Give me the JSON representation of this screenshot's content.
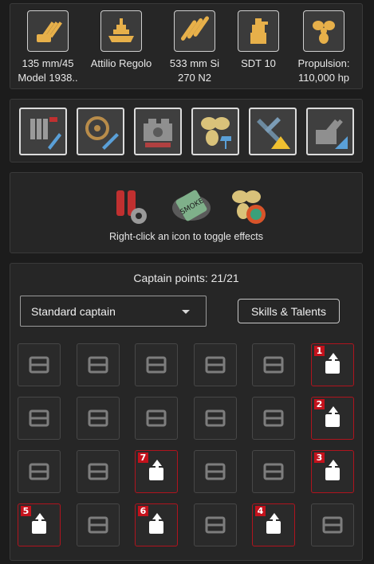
{
  "modules": [
    {
      "icon": "main-battery-icon",
      "line1": "135 mm/45",
      "line2": "Model 1938.."
    },
    {
      "icon": "hull-icon",
      "line1": "Attilio Regolo",
      "line2": ""
    },
    {
      "icon": "torpedo-icon",
      "line1": "533 mm Si",
      "line2": "270 N2"
    },
    {
      "icon": "fire-control-icon",
      "line1": "SDT 10",
      "line2": ""
    },
    {
      "icon": "propulsion-icon",
      "line1": "Propulsion:",
      "line2": "110,000 hp"
    }
  ],
  "upgrades": [
    {
      "icon": "main-armaments-mod-icon"
    },
    {
      "icon": "damage-control-mod-icon"
    },
    {
      "icon": "engine-room-mod-icon"
    },
    {
      "icon": "propulsion-mod-icon"
    },
    {
      "icon": "aircraft-warning-mod-icon"
    },
    {
      "icon": "gun-fire-control-mod-icon"
    }
  ],
  "consumables": {
    "items": [
      {
        "icon": "damage-control-party-icon"
      },
      {
        "icon": "smoke-generator-icon",
        "text": "SMOKE"
      },
      {
        "icon": "engine-boost-icon"
      }
    ],
    "hint": "Right-click an icon to toggle effects"
  },
  "captain": {
    "points_label": "Captain points: 21/21",
    "select_value": "Standard captain",
    "skills_button": "Skills & Talents",
    "accent": "#c4121c",
    "skills": [
      {
        "icon": "grease-the-gears-icon",
        "order": null
      },
      {
        "icon": "gun-feeder-icon",
        "order": null
      },
      {
        "icon": "torpedo-armament-expertise-icon",
        "order": null
      },
      {
        "icon": "consumables-specialist-icon",
        "order": null
      },
      {
        "icon": "preventive-maintenance-icon",
        "order": null
      },
      {
        "icon": "priority-target-icon",
        "order": "1"
      },
      {
        "icon": "demolition-expert-icon",
        "order": null
      },
      {
        "icon": "main-battery-specialist-icon",
        "order": null
      },
      {
        "icon": "torpedo-aiming-icon",
        "order": null
      },
      {
        "icon": "inertia-fuse-icon",
        "order": null
      },
      {
        "icon": "incoming-fire-alert-icon",
        "order": null
      },
      {
        "icon": "consumables-enhancements-icon",
        "order": "2"
      },
      {
        "icon": "secondary-armament-icon",
        "order": null
      },
      {
        "icon": "main-battery-reload-icon",
        "order": null
      },
      {
        "icon": "swift-fish-icon",
        "order": "7"
      },
      {
        "icon": "aa-defense-icon",
        "order": null
      },
      {
        "icon": "fill-the-tubes-icon",
        "order": null
      },
      {
        "icon": "superintendent-icon",
        "order": "3"
      },
      {
        "icon": "expert-loader-icon",
        "order": "5"
      },
      {
        "icon": "last-stand-icon",
        "order": null
      },
      {
        "icon": "radio-location-icon",
        "order": "6"
      },
      {
        "icon": "adrenaline-rush-icon",
        "order": null
      },
      {
        "icon": "concealment-expert-icon",
        "order": "4"
      },
      {
        "icon": "dead-eye-icon",
        "order": null
      }
    ]
  }
}
